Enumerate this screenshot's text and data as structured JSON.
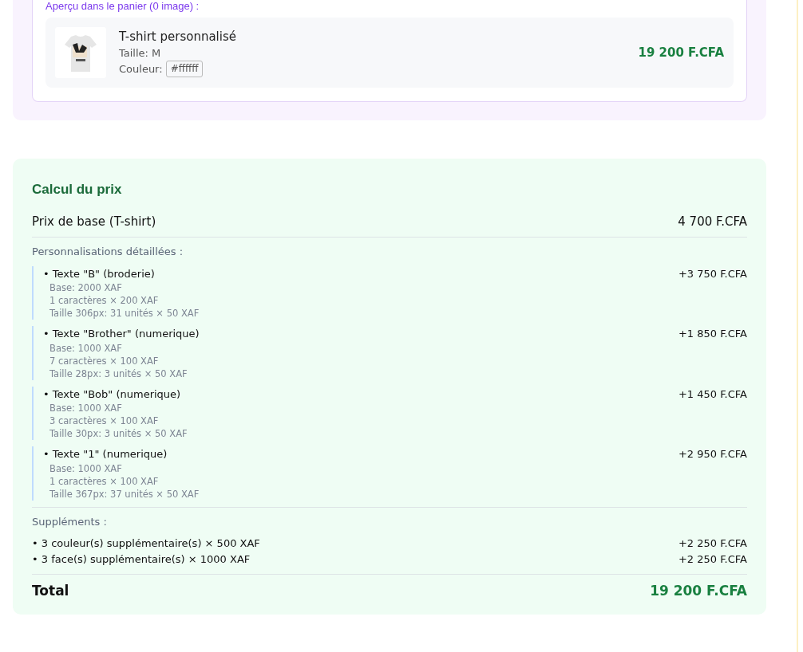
{
  "preview": {
    "title": "Aperçu dans le panier (0 image) :",
    "item": {
      "name": "T-shirt personnalisé",
      "size": "Taille: M",
      "color_label": "Couleur:",
      "color_value": "#ffffff",
      "price": "19 200 F.CFA"
    }
  },
  "pricing": {
    "title": "Calcul du prix",
    "base": {
      "label": "Prix de base (T-shirt)",
      "amount": "4 700 F.CFA"
    },
    "customizations_title": "Personnalisations détaillées :",
    "customizations": [
      {
        "label": "• Texte \"B\" (broderie)",
        "amount": "+3 750 F.CFA",
        "details": [
          "Base: 2000 XAF",
          "1 caractères × 200 XAF",
          "Taille 306px: 31 unités × 50 XAF"
        ]
      },
      {
        "label": "• Texte \"Brother\" (numerique)",
        "amount": "+1 850 F.CFA",
        "details": [
          "Base: 1000 XAF",
          "7 caractères × 100 XAF",
          "Taille 28px: 3 unités × 50 XAF"
        ]
      },
      {
        "label": "• Texte \"Bob\" (numerique)",
        "amount": "+1 450 F.CFA",
        "details": [
          "Base: 1000 XAF",
          "3 caractères × 100 XAF",
          "Taille 30px: 3 unités × 50 XAF"
        ]
      },
      {
        "label": "• Texte \"1\" (numerique)",
        "amount": "+2 950 F.CFA",
        "details": [
          "Base: 1000 XAF",
          "1 caractères × 100 XAF",
          "Taille 367px: 37 unités × 50 XAF"
        ]
      }
    ],
    "supplements_title": "Suppléments :",
    "supplements": [
      {
        "label": "• 3 couleur(s) supplémentaire(s) × 500 XAF",
        "amount": "+2 250 F.CFA"
      },
      {
        "label": "• 3 face(s) supplémentaire(s) × 1000 XAF",
        "amount": "+2 250 F.CFA"
      }
    ],
    "total": {
      "label": "Total",
      "amount": "19 200 F.CFA"
    }
  }
}
